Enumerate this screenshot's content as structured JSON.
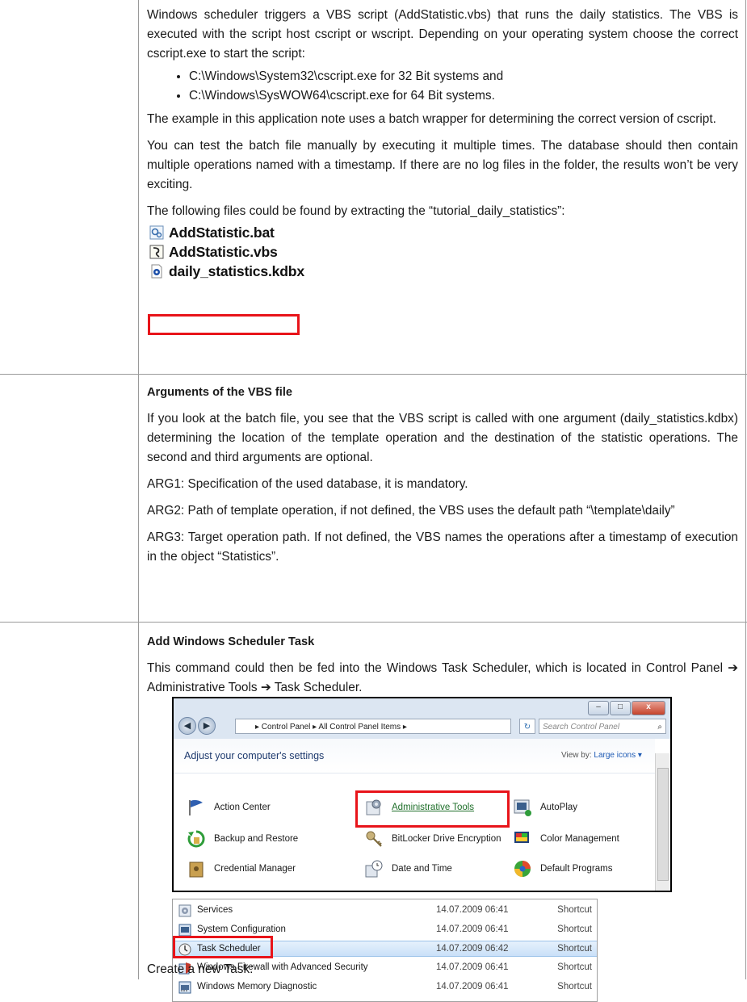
{
  "section1": {
    "para1": "Windows scheduler triggers a VBS script (AddStatistic.vbs) that runs the daily statistics. The VBS is executed with the script host cscript or wscript. Depending on your operating system choose the correct cscript.exe to start the script:",
    "bullets": [
      "C:\\Windows\\System32\\cscript.exe for 32 Bit systems and",
      "C:\\Windows\\SysWOW64\\cscript.exe for 64 Bit systems."
    ],
    "para2": "The example in this application note uses a batch wrapper for determining the correct version of cscript.",
    "para3": "You can test the batch file manually by executing it multiple times. The database should then contain multiple operations named with a timestamp. If there are no log files in the folder, the results won’t be very exciting.",
    "para4": "The following files could be found by extracting the “tutorial_daily_statistics”:",
    "files": [
      "AddStatistic.bat",
      "AddStatistic.vbs",
      "daily_statistics.kdbx"
    ]
  },
  "section2": {
    "title": "Arguments of the VBS file",
    "para1": "If you look at the batch file, you see that the VBS script is called with one argument (daily_statistics.kdbx) determining the location of the template operation and the destination of the statistic operations. The second and third arguments are optional.",
    "arg1": "ARG1: Specification of the used database, it is mandatory.",
    "arg2": "ARG2: Path of template operation, if not defined, the VBS uses the default path “\\template\\daily”",
    "arg3": "ARG3: Target operation path. If not defined, the VBS names the operations after a timestamp of execution in the object “Statistics”."
  },
  "section3": {
    "title": "Add Windows Scheduler Task",
    "para1": "This command could then be fed into the Windows Task Scheduler, which is located in Control Panel ➔ Administrative Tools ➔ Task Scheduler.",
    "control_panel": {
      "address": "▸ Control Panel ▸ All Control Panel Items ▸",
      "search_placeholder": "Search Control Panel",
      "heading": "Adjust your computer's settings",
      "view_by_label": "View by:",
      "view_by_value": "Large icons ▾",
      "items": [
        "Action Center",
        "Administrative Tools",
        "AutoPlay",
        "Backup and Restore",
        "BitLocker Drive Encryption",
        "Color Management",
        "Credential Manager",
        "Date and Time",
        "Default Programs"
      ]
    },
    "admin_tools": [
      {
        "name": "Services",
        "date": "14.07.2009 06:41",
        "type": "Shortcut"
      },
      {
        "name": "System Configuration",
        "date": "14.07.2009 06:41",
        "type": "Shortcut"
      },
      {
        "name": "Task Scheduler",
        "date": "14.07.2009 06:42",
        "type": "Shortcut"
      },
      {
        "name": "Windows Firewall with Advanced Security",
        "date": "14.07.2009 06:41",
        "type": "Shortcut"
      },
      {
        "name": "Windows Memory Diagnostic",
        "date": "14.07.2009 06:41",
        "type": "Shortcut"
      }
    ],
    "para2": "Create a new Task:"
  }
}
